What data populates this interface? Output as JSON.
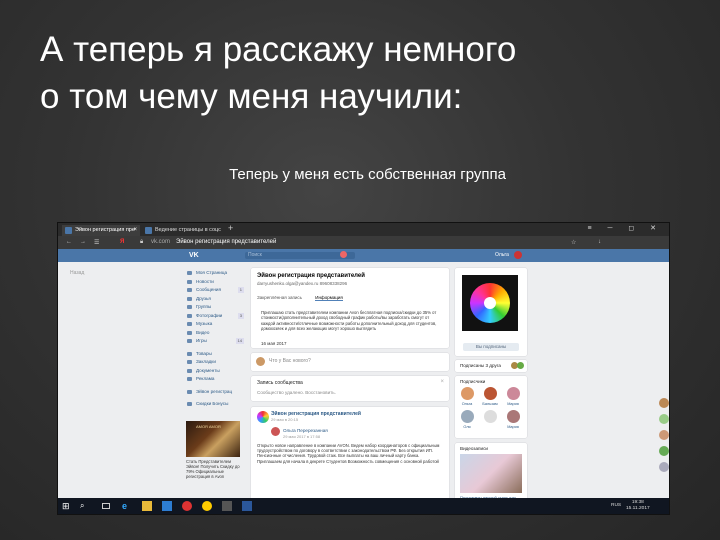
{
  "slide": {
    "title_line1": "А теперь я расскажу немного",
    "title_line2": "о том чему меня научили:",
    "subtitle": "Теперь у меня есть собственная группа"
  },
  "browser": {
    "tab_active": "Эйвон регистрация пре",
    "tab_second": "Ведение страницы в соцс",
    "new_tab": "+",
    "address_domain": "vk.com",
    "address_title": "Эйвон регистрация представителей",
    "yandex": "Я"
  },
  "vk": {
    "logo": "VK",
    "search_placeholder": "Поиск",
    "user_name": "Ольга",
    "back": "Назад",
    "nav": [
      {
        "label": "Моя Страница"
      },
      {
        "label": "Новости"
      },
      {
        "label": "Сообщения",
        "count": "1"
      },
      {
        "label": "Друзья"
      },
      {
        "label": "Группы"
      },
      {
        "label": "Фотографии",
        "count": "3"
      },
      {
        "label": "Музыка"
      },
      {
        "label": "Видео"
      },
      {
        "label": "Игры",
        "count": "14"
      },
      {
        "label": "Товары"
      },
      {
        "label": "Закладки"
      },
      {
        "label": "Документы"
      },
      {
        "label": "Реклама"
      },
      {
        "label": "Эйвон регистрац"
      },
      {
        "label": "Скидки Бонусы"
      }
    ],
    "ad": {
      "image_caption": "AMOR AMOR",
      "text": "Стать Представителем Эйвон! Получить Скидку до 79% Официальные регистрация в Avon"
    },
    "group": {
      "title": "Эйвон регистрация представителей",
      "email": "darryushenko.olga@yandex.ru 89608338296",
      "tab_wall": "Закреплённая запись",
      "tab_info": "Информация",
      "description": "Приглашаю стать представителем компании Avon бесплатная подписка/скидки до 35% от стоимости/дополнительный доход свободный график работы/вы заработать смогут от каждой активности/отличные возможности работы дополнительный доход для студентов, домохозяек и для всех желающих могут хорошо выглядеть",
      "date": "16 мая 2017"
    },
    "new_post_placeholder": "Что у Вас нового?",
    "suggested": {
      "title": "Запись сообщества",
      "text": "Сообщество удалено. Восстановить."
    },
    "post": {
      "group": "Эйвон регистрация представителей",
      "date": "29 мая в 20:15",
      "author": "Ольга Перерезанная",
      "author_date": "29 мая 2017 в 17:58",
      "text": "Открыто новое направление в компании AVON. Ведем набор координаторов с официальным трудоустройством по договору в соответствии с законодательством РФ. Без открытия ИП. Пенсионные отчисления. Трудовой стаж. Все выплаты на ваш личный карту банка. Приглашаем для начала в декрете Студентов Возможность совмещения с основной работой",
      "more": "Показать полностью"
    },
    "sidebar": {
      "subscribe_btn": "Вы подписаны",
      "friends": "Подписаны 3 друга",
      "subscribers_title": "Подписчики",
      "subscriber_names": [
        "Ольга",
        "Бальзам",
        "Мария",
        "Оля",
        "",
        "Мария"
      ],
      "video_title": "Видеозаписи",
      "video_caption": "Программы личный старт для Представителей"
    }
  },
  "taskbar": {
    "lang": "RUS",
    "time": "19:38",
    "date": "15.11.2017"
  },
  "colors": {
    "vk_blue": "#4a76a8",
    "slide_bg": "#333333"
  }
}
